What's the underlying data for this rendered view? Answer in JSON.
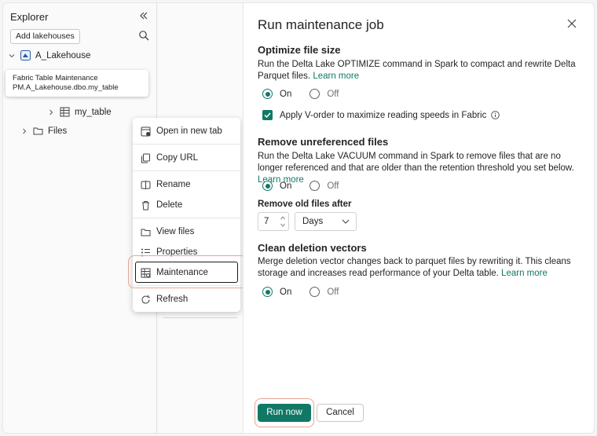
{
  "explorer": {
    "title": "Explorer",
    "add_button": "Add lakehouses",
    "lakehouse": "A_Lakehouse",
    "table": "my_table",
    "files": "Files",
    "tooltip_line1": "Fabric Table Maintenance",
    "tooltip_line2": "PM.A_Lakehouse.dbo.my_table"
  },
  "context_menu": {
    "items": [
      {
        "label": "Open in new tab",
        "icon": "open-new-tab-icon"
      },
      {
        "label": "Copy URL",
        "icon": "copy-icon"
      },
      {
        "label": "Rename",
        "icon": "rename-icon"
      },
      {
        "label": "Delete",
        "icon": "trash-icon"
      },
      {
        "label": "View files",
        "icon": "folder-icon"
      },
      {
        "label": "Properties",
        "icon": "properties-icon"
      },
      {
        "label": "Maintenance",
        "icon": "maintenance-icon"
      },
      {
        "label": "Refresh",
        "icon": "refresh-icon"
      }
    ]
  },
  "dialog": {
    "title": "Run maintenance job",
    "optimize": {
      "title": "Optimize file size",
      "desc": "Run the Delta Lake OPTIMIZE command in Spark to compact and rewrite Delta Parquet files.",
      "link": "Learn more",
      "on_label": "On",
      "off_label": "Off",
      "vorder_label": "Apply V-order to maximize reading speeds in Fabric"
    },
    "vacuum": {
      "title": "Remove unreferenced files",
      "desc": "Run the Delta Lake VACUUM command in Spark to remove files that are no longer referenced and that are older than the retention threshold you set below.",
      "link": "Learn more",
      "on_label": "On",
      "off_label": "Off",
      "retention_label": "Remove old files after",
      "retention_value": "7",
      "retention_unit": "Days"
    },
    "deletion": {
      "title": "Clean deletion vectors",
      "desc": "Merge deletion vector changes back to parquet files by rewriting it. This cleans storage and increases read performance of your Delta table.",
      "link": "Learn more",
      "on_label": "On",
      "off_label": "Off"
    },
    "run_button": "Run now",
    "cancel_button": "Cancel"
  },
  "colors": {
    "accent": "#117865",
    "highlight": "#e8a596"
  }
}
